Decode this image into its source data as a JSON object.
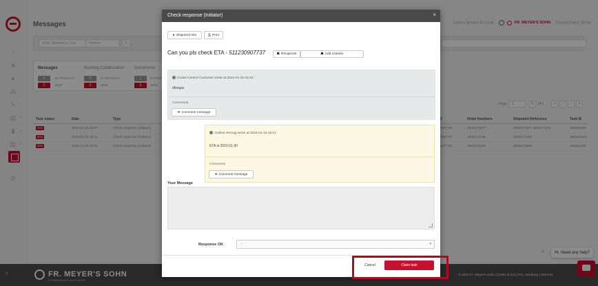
{
  "app": {
    "title": "Messages",
    "topbar": {
      "text": "Control Service Account",
      "logo": "FR. MEYER'S SOHN",
      "user": "CruiseControl_Demo"
    },
    "search": {
      "placeholder1": "SSID, Reference, Con",
      "placeholder2": "Partner"
    },
    "summary": {
      "tabs": [
        "Messages",
        "Booking Collaboration",
        "Documents"
      ],
      "messages": {
        "in_process": "0",
        "in_process_label": "IN PROCESS",
        "new": "3",
        "new_label": "NEW"
      },
      "booking": {
        "in_process": "0",
        "in_process_label": "IN PROCESS",
        "new": "0",
        "new_label": "NEW"
      },
      "documents": {
        "in_process": "1",
        "in_process_label": "IN PROCE",
        "new": "0",
        "new_label": "NEW"
      }
    },
    "pager": {
      "label": "Page",
      "page": "1",
      "of": "of 1"
    },
    "table": {
      "headers": [
        "Task status",
        "Date",
        "Type",
        "D",
        "Order Numbers",
        "Shipment Reference",
        "Task ID"
      ],
      "rows": [
        {
          "status": "NEW",
          "date": "2024-01-15 15:07",
          "type": "Check response (Initiator)",
          "d": "30907735",
          "orders": "4500171677",
          "ref": "4500171677 4500171671",
          "id": "355868100"
        },
        {
          "status": "NEW",
          "date": "2024-01-15 15:11",
          "type": "Check response (Initiator)",
          "d": "30907737",
          "orders": "4500171785",
          "ref": "4500171789",
          "id": "355622529"
        },
        {
          "status": "NEW",
          "date": "2024-01-15 15:01",
          "type": "Check response (Initiator)",
          "d": "30907740",
          "orders": "4500171665",
          "ref": "4500171665",
          "id": "355622165"
        }
      ]
    },
    "footer": {
      "logo": "FR. MEYER'S SOHN",
      "sub": "FORWARDING BUSINESS",
      "copyright": "© 2024 Fr. Meyer's Sohn (GmbH & CO.) KG, Hamburg | 2024-01"
    },
    "help": {
      "text": "Hi. Need any help?",
      "close": "×"
    }
  },
  "modal": {
    "title": "Check response (Initiator)",
    "close": "×",
    "buttons": {
      "shipment_info": "Shipment Info",
      "print": "Print",
      "recipients": "Recipients",
      "add_listener": "Add Listener"
    },
    "subject_prefix": "Can you pls check ETA - ",
    "subject_ref": "511230907737",
    "messages": [
      {
        "author": "Cruise Control Customer wrote at 2024-01-15 15:10:",
        "body": "dfsegas",
        "comments_label": "Comments",
        "comment_btn": "Comment message"
      },
      {
        "author": "Andrea Herzog wrote at 2024-01-15 15:11:",
        "body": "ETA is 2023-01-30",
        "comments_label": "Comments",
        "comment_btn": "Comment message"
      }
    ],
    "your_message_label": "Your Message",
    "your_message_value": "",
    "response_label": "Response OK",
    "response_value": "-",
    "cancel": "Cancel",
    "claim": "Claim task"
  },
  "colors": {
    "accent": "#c8102e",
    "header": "#4a4a4a",
    "highlight": "#b10a1f"
  }
}
